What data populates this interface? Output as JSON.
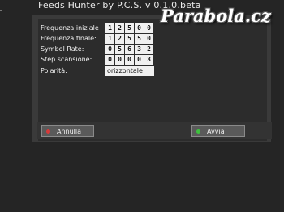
{
  "title": "Feeds Hunter by P.C.S. v 0.1.0.beta",
  "watermark": "Parabola.cz",
  "fields": [
    {
      "label": "Frequenza iniziale",
      "digits": [
        "1",
        "2",
        "5",
        "0",
        "0"
      ]
    },
    {
      "label": "Frequenza finale:",
      "digits": [
        "1",
        "2",
        "5",
        "5",
        "0"
      ]
    },
    {
      "label": "Symbol Rate:",
      "digits": [
        "0",
        "5",
        "6",
        "3",
        "2"
      ]
    },
    {
      "label": "Step scansione:",
      "digits": [
        "0",
        "0",
        "0",
        "0",
        "3"
      ]
    }
  ],
  "polarity": {
    "label": "Polarità:",
    "value": "orizzontale"
  },
  "buttons": {
    "cancel": {
      "label": "Annulla",
      "color": "#d83a3a"
    },
    "start": {
      "label": "Avvia",
      "color": "#3ec23e"
    }
  }
}
